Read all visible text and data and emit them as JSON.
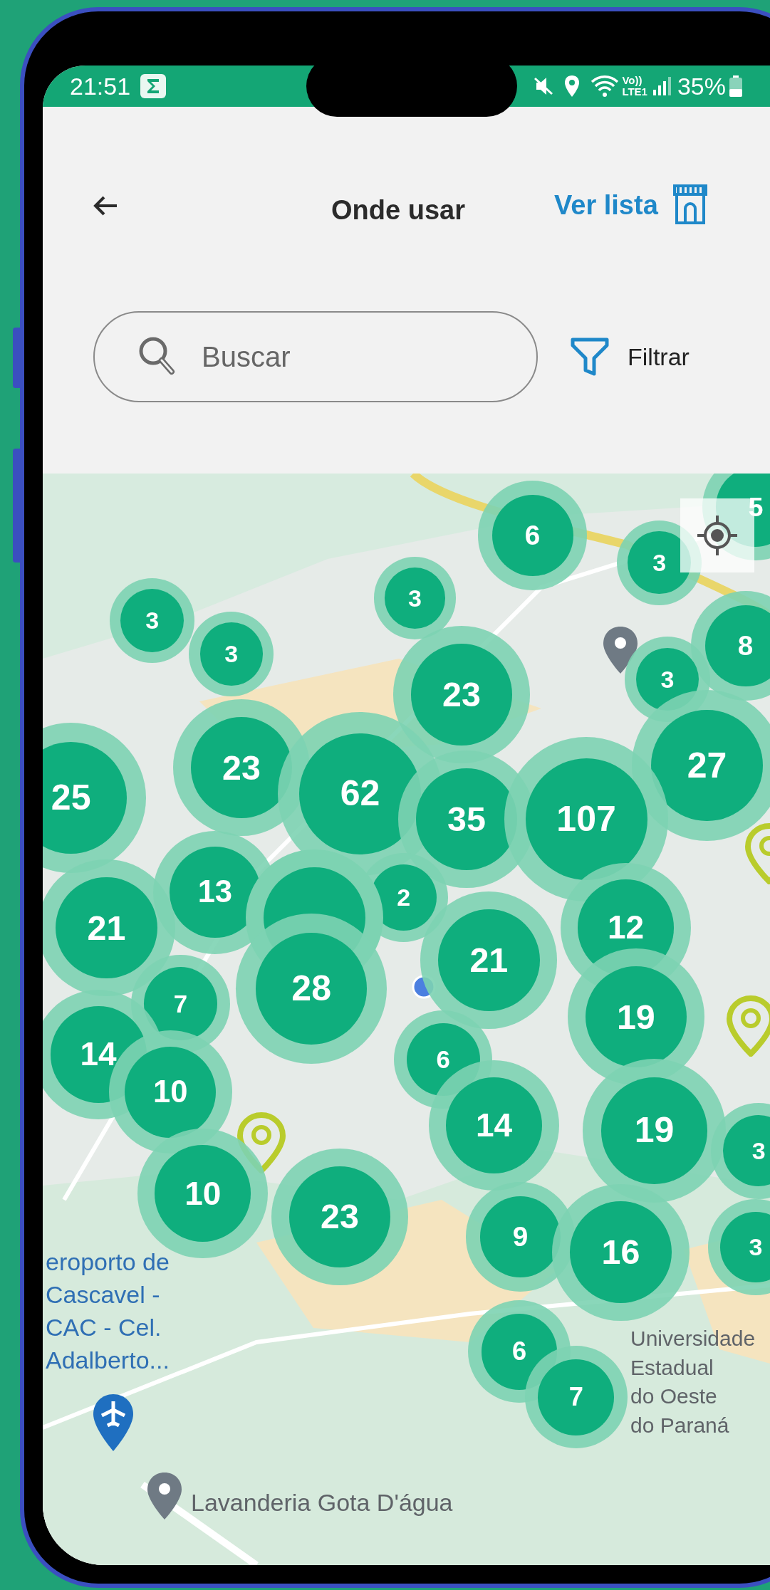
{
  "status_bar": {
    "time": "21:51",
    "network_label": [
      "Vo))",
      "LTE1"
    ],
    "battery": "35%"
  },
  "header": {
    "title": "Onde usar",
    "list_link": "Ver lista"
  },
  "search": {
    "placeholder": "Buscar"
  },
  "filter": {
    "label": "Filtrar"
  },
  "map": {
    "labels": [
      {
        "text": "Universidade\nEstadual\ndo Oeste\ndo Paraná",
        "kind": "place"
      },
      {
        "text": "eroporto de\nCascavel -\nCAC - Cel.\nAdalberto...",
        "kind": "airport"
      },
      {
        "text": "Lavanderia Gota D'água",
        "kind": "place"
      }
    ],
    "clusters": [
      {
        "count": "5"
      },
      {
        "count": "6"
      },
      {
        "count": "3"
      },
      {
        "count": "3"
      },
      {
        "count": "3"
      },
      {
        "count": "3"
      },
      {
        "count": "8"
      },
      {
        "count": "3"
      },
      {
        "count": "23"
      },
      {
        "count": "23"
      },
      {
        "count": "25"
      },
      {
        "count": "27"
      },
      {
        "count": "62"
      },
      {
        "count": "35"
      },
      {
        "count": "107"
      },
      {
        "count": "13"
      },
      {
        "count": "21"
      },
      {
        "count": "2"
      },
      {
        "count": "21"
      },
      {
        "count": "12"
      },
      {
        "count": "28"
      },
      {
        "count": "7"
      },
      {
        "count": "19"
      },
      {
        "count": "14"
      },
      {
        "count": "6"
      },
      {
        "count": "10"
      },
      {
        "count": "14"
      },
      {
        "count": "19"
      },
      {
        "count": "3"
      },
      {
        "count": "10"
      },
      {
        "count": "23"
      },
      {
        "count": "9"
      },
      {
        "count": "16"
      },
      {
        "count": "3"
      },
      {
        "count": "6"
      },
      {
        "count": "7"
      }
    ]
  }
}
